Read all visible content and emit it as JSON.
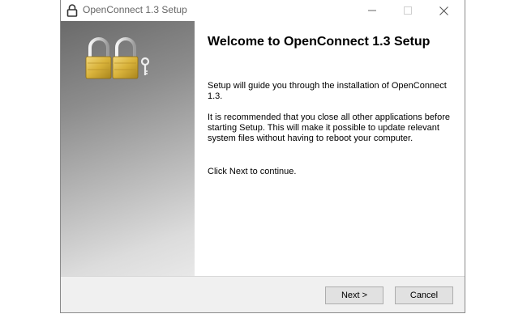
{
  "window": {
    "title": "OpenConnect 1.3 Setup"
  },
  "content": {
    "heading": "Welcome to OpenConnect 1.3 Setup",
    "paragraph_1": "Setup will guide you through the installation of OpenConnect 1.3.",
    "paragraph_2": "It is recommended that you close all other applications before starting Setup. This will make it possible to update relevant system files without having to reboot your computer.",
    "paragraph_3": "Click Next to continue."
  },
  "footer": {
    "next_label": "Next >",
    "cancel_label": "Cancel"
  },
  "icons": {
    "title": "lock-icon",
    "sidebar": "padlocks-and-key-icon",
    "minimize": "minimize-icon",
    "maximize": "maximize-icon",
    "close": "close-icon"
  },
  "colors": {
    "lock_gold": "#d8b23a",
    "sidebar_dark": "#6a6a6a",
    "sidebar_light": "#e8e8e8"
  }
}
